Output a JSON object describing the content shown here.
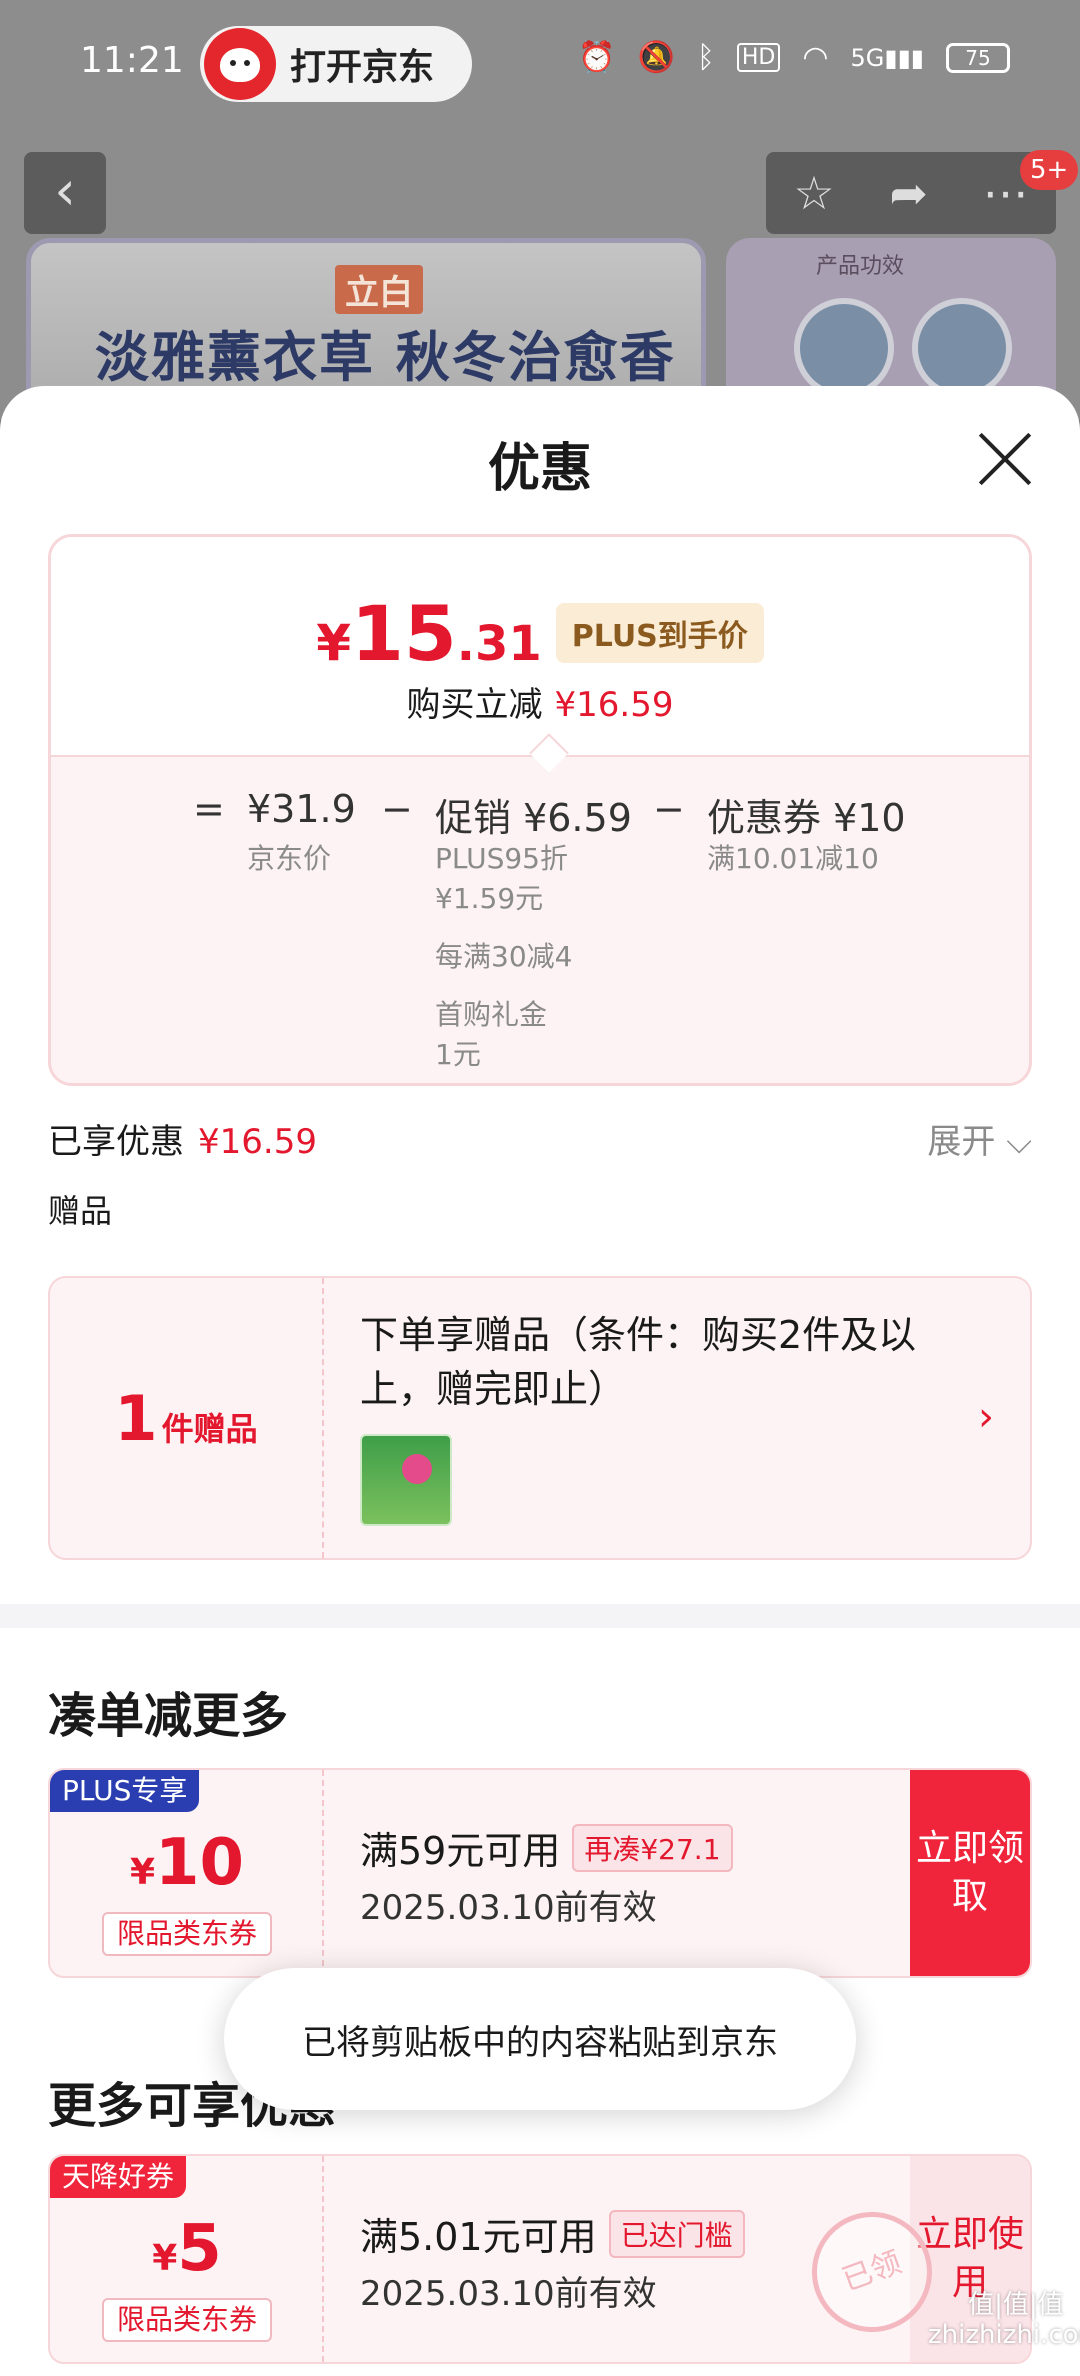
{
  "status_bar": {
    "time": "11:21",
    "app_pill": "打开京东",
    "battery": "75",
    "icons": [
      "alarm-icon",
      "mute-icon",
      "bluetooth-icon",
      "hd-icon",
      "wifi-icon",
      "5g-signal-icon"
    ]
  },
  "background_page": {
    "notification_badge": "5+",
    "banner_brand": "立白",
    "banner_title": "淡雅薰衣草 秋冬治愈香",
    "banner_right_title": "产品功效"
  },
  "sheet": {
    "title": "优惠",
    "price": {
      "yen": "¥",
      "integer": "15",
      "decimal": ".31",
      "tag": "PLUS到手价"
    },
    "reduce": {
      "label": "购买立减",
      "value": "¥16.59"
    },
    "calc": {
      "eq": "=",
      "minus": "−",
      "base": {
        "value": "¥31.9",
        "label": "京东价"
      },
      "promo": {
        "value": "促销 ¥6.59",
        "lines": [
          "PLUS95折",
          "¥1.59元",
          "每满30减4",
          "首购礼金",
          "1元"
        ]
      },
      "coupon": {
        "value": "优惠券 ¥10",
        "label": "满10.01减10"
      }
    },
    "enjoyed": {
      "label": "已享优惠",
      "value": "¥16.59"
    },
    "expand": "展开 ⌵",
    "gift_section": "赠品",
    "gift_card": {
      "count": "1",
      "unit": "件赠品",
      "text": "下单享赠品（条件：购买2件及以上，赠完即止）"
    },
    "section_more": "凑单减更多",
    "coupon1": {
      "tag": "PLUS专享",
      "yen": "¥",
      "amount": "10",
      "type": "限品类东券",
      "condition": "满59元可用",
      "chip": "再凑¥27.1",
      "valid": "2025.03.10前有效",
      "button": "立即领取"
    },
    "section_enjoy": "更多可享优惠",
    "coupon2": {
      "tag": "天降好券",
      "yen": "¥",
      "amount": "5",
      "type": "限品类东券",
      "condition": "满5.01元可用",
      "chip": "已达门槛",
      "valid": "2025.03.10前有效",
      "button": "立即使用",
      "stamp": "已领"
    },
    "toast": "已将剪贴板中的内容粘贴到京东",
    "watermark": "值|值|值 zhizhizhi.com"
  },
  "colors": {
    "accent": "#e3172d",
    "plus_tag_bg": "#fbedd5",
    "card_bg": "#fdf3f4"
  }
}
